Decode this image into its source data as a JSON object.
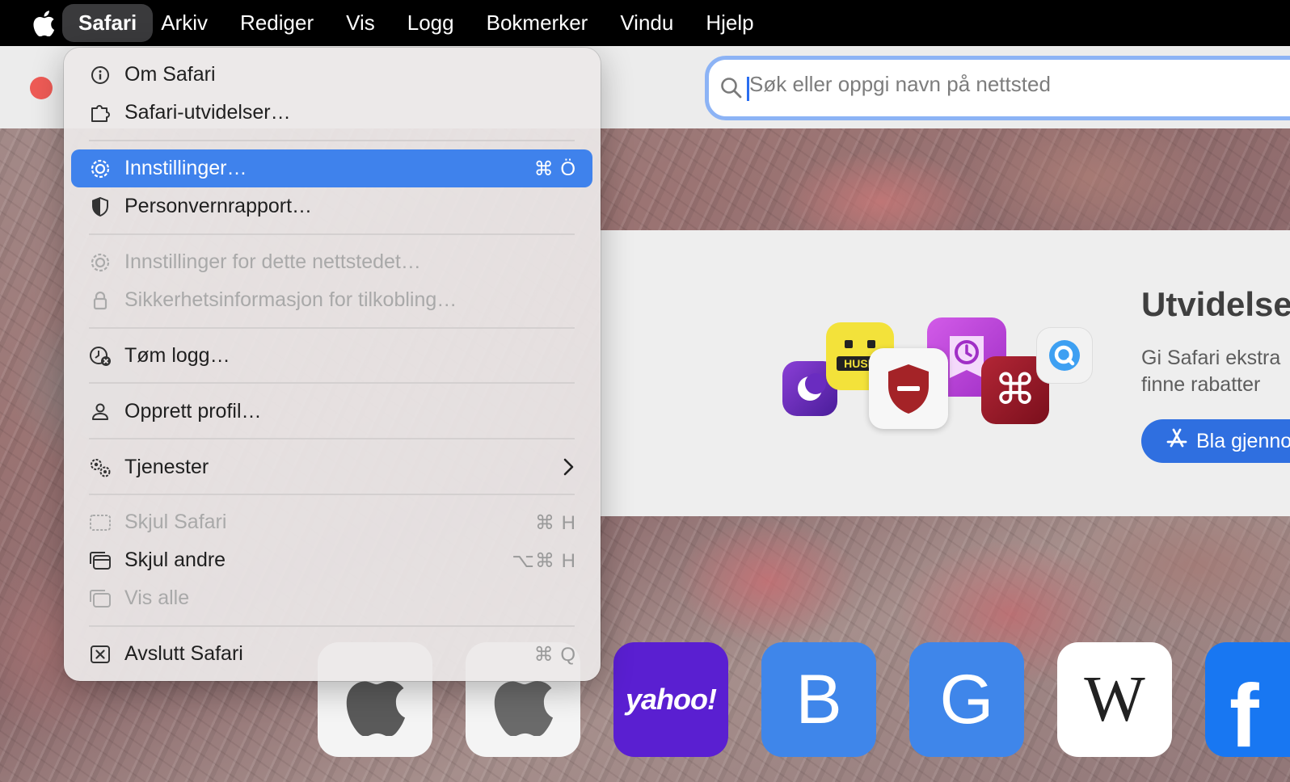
{
  "menubar": {
    "items": [
      "Safari",
      "Arkiv",
      "Rediger",
      "Vis",
      "Logg",
      "Bokmerker",
      "Vindu",
      "Hjelp"
    ],
    "active": "Safari"
  },
  "toolbar": {
    "search_placeholder": "Søk eller oppgi navn på nettsted"
  },
  "extensions": {
    "title": "Utvidelser",
    "description_line1": "Gi Safari ekstra",
    "description_line2": "finne rabatter",
    "button_label": "Bla gjennom"
  },
  "favorites": {
    "yahoo": "yahoo!",
    "bing": "B",
    "google": "G",
    "wikipedia": "W",
    "facebook": "f"
  },
  "menu": {
    "about": "Om Safari",
    "extensions": "Safari-utvidelser…",
    "settings": "Innstillinger…",
    "settings_shortcut": "⌘ Ö",
    "privacy_report": "Personvernrapport…",
    "site_settings": "Innstillinger for dette nettstedet…",
    "connection_security": "Sikkerhetsinformasjon for tilkobling…",
    "clear_history": "Tøm logg…",
    "create_profile": "Opprett profil…",
    "services": "Tjenester",
    "hide_safari": "Skjul Safari",
    "hide_safari_shortcut": "⌘ H",
    "hide_others": "Skjul andre",
    "hide_others_shortcut": "⌥⌘ H",
    "show_all": "Vis alle",
    "quit": "Avslutt Safari",
    "quit_shortcut": "⌘ Q"
  },
  "colors": {
    "menu_highlight": "#3f82ec",
    "accent_blue": "#2f6fe0",
    "close_red": "#ee5b56"
  }
}
